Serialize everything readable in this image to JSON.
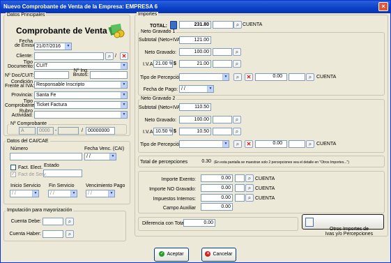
{
  "window": {
    "title": "Nuevo Comprobante de Venta de la Empresa: EMPRESA 6",
    "close": "×"
  },
  "left": {
    "datos_principales": "Datos Principales",
    "heading": "Comprobante de Venta",
    "fecha_emision_label": "Fecha\nde Emisión:",
    "fecha_emision": "21/07/2016",
    "cliente_label": "Cliente:",
    "cliente_value": "",
    "tipo_documento_label": "Tipo\nDocumento:",
    "tipo_documento": "CUIT",
    "nro_doc_label": "Nº Doc/CUIT:",
    "nro_ing_label": "Nº Ing.\nBrutos:",
    "condicion_label": "Condición\nFrente al IVA:",
    "condicion": "Responsable Inscripto",
    "provincia_label": "Provincia:",
    "provincia": "Santa Fe",
    "tipo_comprobante_label": "Tipo\nComprobante:",
    "tipo_comprobante": "Ticket Factura",
    "rubro_label": "Rubro\nActividad:",
    "rubro": "",
    "nro_comprobante_label": "Nº Comprobante",
    "letra": "A",
    "punto_venta": "0000",
    "sep1": "-",
    "sep2": "/",
    "numero": "00000000"
  },
  "cai": {
    "title": "Datos del CAI/CAE",
    "numero_label": "Número",
    "fecha_venc_label": "Fecha Venc. (CAI)",
    "fecha_venc": "/ /",
    "fact_elect": "Fact. Elect.",
    "estado_label": "Estado",
    "fact_serv": "Fact de Serv.",
    "inicio_label": "Inicio Servicio",
    "fin_label": "Fin Servicio",
    "venc_pago_label": "Vencimiento Pago",
    "inicio": "/ /",
    "fin": "/ /",
    "venc_pago": "/ /"
  },
  "imputacion": {
    "title": "Imputación para mayorización",
    "debe_label": "Cuenta Debe:",
    "haber_label": "Cuenta Haber:"
  },
  "importes": {
    "title": "Importes",
    "total_label": "TOTAL:",
    "total": "231.80",
    "cuenta": "CUENTA",
    "ng1": {
      "title": "Neto Gravado 1",
      "subtotal_label": "Subtotal (Neto+IVA):",
      "subtotal": "121.00",
      "neto_label": "Neto Gravado:",
      "neto": "100.00",
      "iva_label": "I.V.A",
      "iva_rate": "21.00 %",
      "iva_symbol": "$",
      "iva": "21.00",
      "percepcion_label": "Tipo de Percepción:",
      "percepcion_value": "0.00",
      "fecha_pago_label": "Fecha de Pago:",
      "fecha_pago": "/ /"
    },
    "ng2": {
      "title": "Neto Gravado 2",
      "subtotal_label": "Subtotal (Neto+IVA):",
      "subtotal": "110.50",
      "neto_label": "Neto Gravado:",
      "neto": "100.00",
      "iva_label": "I.V.A",
      "iva_rate": "10.50 %",
      "iva_symbol": "$",
      "iva": "10.50",
      "percepcion_label": "Tipo de Percepción:",
      "percepcion_value": "0.00"
    },
    "total_percepciones_label": "Total de percepciones",
    "total_percepciones": "0.30",
    "percepciones_note": "(En esta pantalla se muestran solo 2 percepciones vea el  detalle en \"Otros Importes...\")",
    "exento_label": "Importe Exento:",
    "exento": "0.00",
    "no_gravado_label": "Importe NO Gravado:",
    "no_gravado": "0.00",
    "internos_label": "Impuestos Internos:",
    "internos": "0.00",
    "campo_aux_label": "Campo Auxiliar",
    "campo_aux": "0.00",
    "otros_btn": "Otros Importes de\nIvas y/o Percepciones",
    "diferencia_label": "Diferencia con Total",
    "diferencia": "0.00"
  },
  "buttons": {
    "aceptar": "Aceptar",
    "cancelar": "Cancelar"
  }
}
